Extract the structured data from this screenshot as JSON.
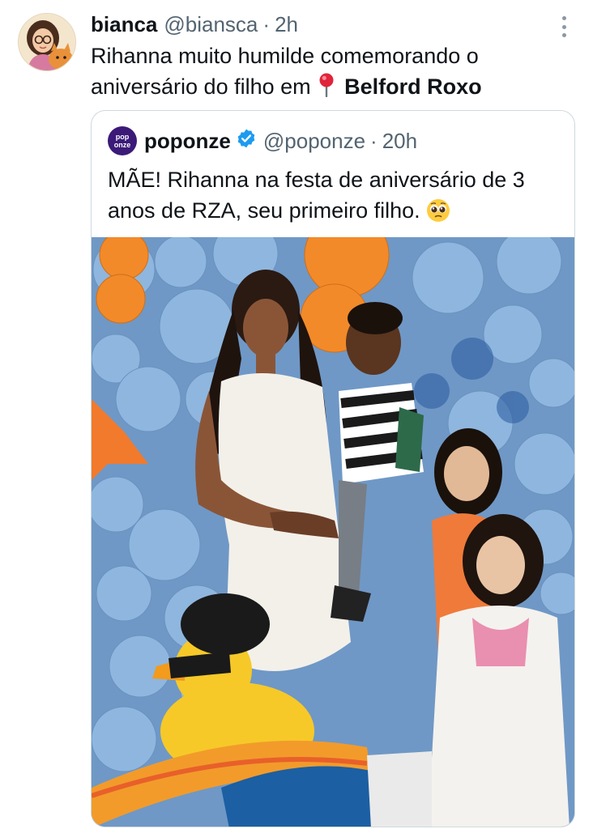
{
  "tweet": {
    "display_name": "bianca",
    "handle": "@biansca",
    "separator": "·",
    "time": "2h",
    "text": "Rihanna muito humilde comemorando o aniversário do filho em",
    "location_icon": "round-pushpin-icon",
    "location": "Belford Roxo"
  },
  "quoted_tweet": {
    "display_name": "poponze",
    "avatar_logo_top": "pop",
    "avatar_logo_bottom": "onze",
    "verified": true,
    "handle": "@poponze",
    "separator": "·",
    "time": "20h",
    "text": "MÃE! Rihanna na festa de aniversário de 3 anos de RZA, seu primeiro filho.",
    "emoji": "pleading-face-icon"
  },
  "colors": {
    "secondary_text": "#536471",
    "verified_blue": "#1d9bf0",
    "border": "#cfd9de",
    "poponze_brand": "#3b1a78"
  }
}
